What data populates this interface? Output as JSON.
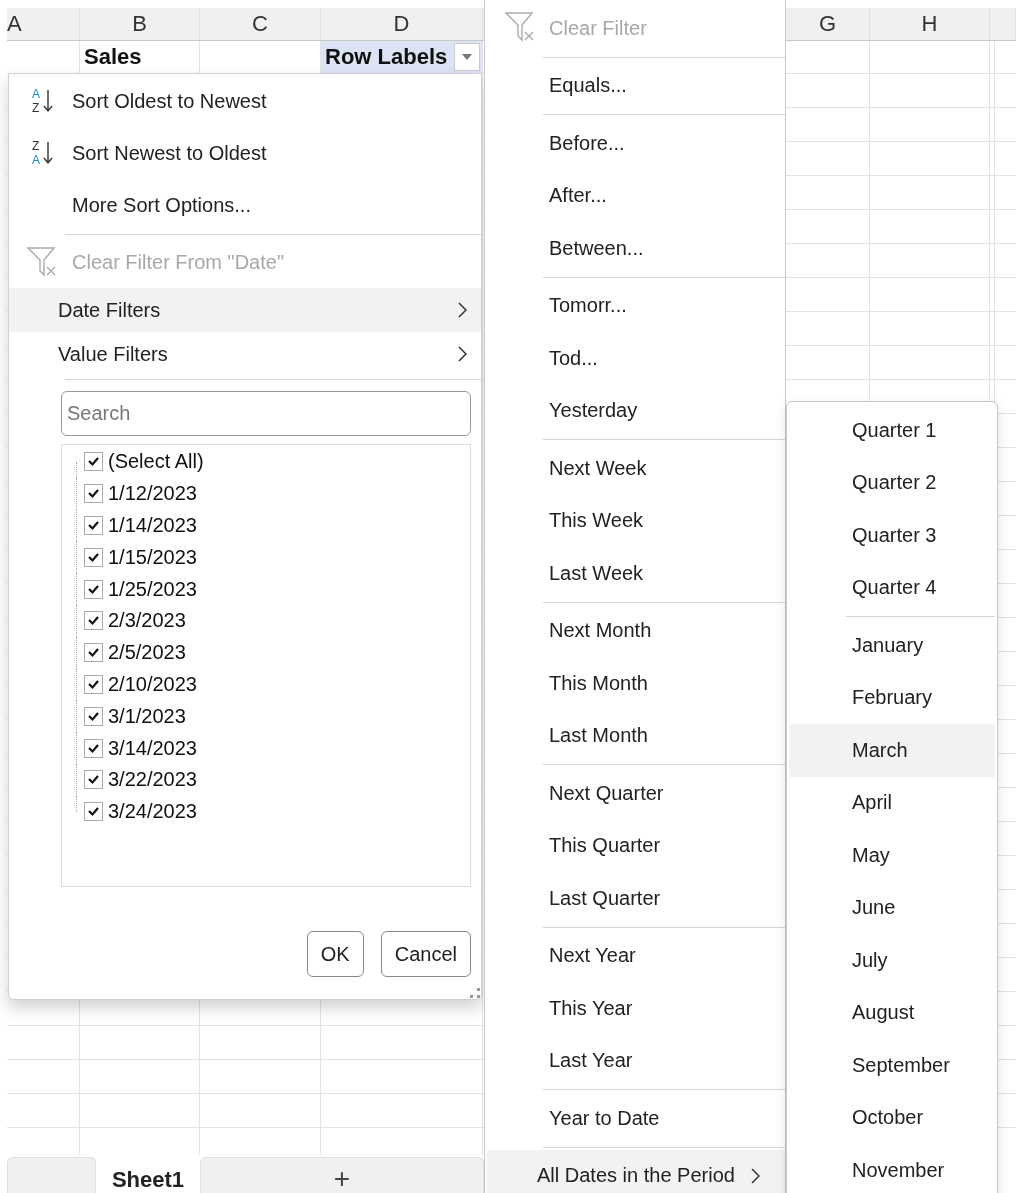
{
  "sheet": {
    "columns": [
      "A",
      "B",
      "C",
      "D",
      "G",
      "H"
    ],
    "cells": [
      {
        "text": "Sales",
        "kind": "plain"
      },
      {
        "text": "Row Labels",
        "kind": "filter"
      }
    ],
    "tabs": [
      {
        "label": "Sheet1",
        "selected": true
      }
    ],
    "add_sheet": "+"
  },
  "filter_panel": {
    "sort_items": [
      {
        "label": "Sort Oldest to Newest",
        "icon": {
          "top": "A",
          "bottom": "Z",
          "kind": "ascending"
        }
      },
      {
        "label": "Sort Newest to Oldest",
        "icon": {
          "top": "Z",
          "bottom": "A",
          "kind": "descending"
        }
      },
      {
        "label": "More Sort Options..."
      }
    ],
    "clear_filter": {
      "label": "Clear Filter From \"Date\"",
      "disabled": true
    },
    "submenus": [
      {
        "label": "Date Filters",
        "selected": true
      },
      {
        "label": "Value Filters",
        "selected": false
      }
    ],
    "search": {
      "placeholder": "Search"
    },
    "checklist": [
      {
        "label": "(Select All)",
        "checked": true
      },
      {
        "label": "1/12/2023",
        "checked": true
      },
      {
        "label": "1/14/2023",
        "checked": true
      },
      {
        "label": "1/15/2023",
        "checked": true
      },
      {
        "label": "1/25/2023",
        "checked": true
      },
      {
        "label": "2/3/2023",
        "checked": true
      },
      {
        "label": "2/5/2023",
        "checked": true
      },
      {
        "label": "2/10/2023",
        "checked": true
      },
      {
        "label": "3/1/2023",
        "checked": true
      },
      {
        "label": "3/14/2023",
        "checked": true
      },
      {
        "label": "3/22/2023",
        "checked": true
      },
      {
        "label": "3/24/2023",
        "checked": true
      }
    ],
    "buttons": [
      "OK",
      "Cancel"
    ]
  },
  "date_filters_menu": {
    "groups": [
      [
        {
          "label": "Clear Filter",
          "kind": "clear",
          "disabled": true
        }
      ],
      [
        {
          "label": "Equals..."
        }
      ],
      [
        {
          "label": "Before..."
        },
        {
          "label": "After..."
        },
        {
          "label": "Between..."
        }
      ],
      [
        {
          "label": "Tomorr..."
        },
        {
          "label": "Tod..."
        },
        {
          "label": "Yesterday"
        }
      ],
      [
        {
          "label": "Next Week"
        },
        {
          "label": "This Week"
        },
        {
          "label": "Last Week"
        }
      ],
      [
        {
          "label": "Next Month"
        },
        {
          "label": "This Month"
        },
        {
          "label": "Last Month"
        }
      ],
      [
        {
          "label": "Next Quarter"
        },
        {
          "label": "This Quarter"
        },
        {
          "label": "Last Quarter"
        }
      ],
      [
        {
          "label": "Next Year"
        },
        {
          "label": "This Year"
        },
        {
          "label": "Last Year"
        }
      ],
      [
        {
          "label": "Year to Date"
        }
      ],
      [
        {
          "label": "All Dates in the Period",
          "kind": "submenu",
          "selected": true
        }
      ]
    ]
  },
  "period_menu": {
    "groups": [
      [
        {
          "label": "Quarter 1",
          "selected": false
        },
        {
          "label": "Quarter 2",
          "selected": false
        },
        {
          "label": "Quarter 3",
          "selected": false
        },
        {
          "label": "Quarter 4",
          "selected": false
        }
      ],
      [
        {
          "label": "January",
          "selected": false
        },
        {
          "label": "February",
          "selected": false
        },
        {
          "label": "March",
          "selected": true
        },
        {
          "label": "April",
          "selected": false
        },
        {
          "label": "May",
          "selected": false
        },
        {
          "label": "June",
          "selected": false
        },
        {
          "label": "July",
          "selected": false
        },
        {
          "label": "August",
          "selected": false
        },
        {
          "label": "September",
          "selected": false
        },
        {
          "label": "October",
          "selected": false
        },
        {
          "label": "November",
          "selected": false
        }
      ]
    ]
  }
}
